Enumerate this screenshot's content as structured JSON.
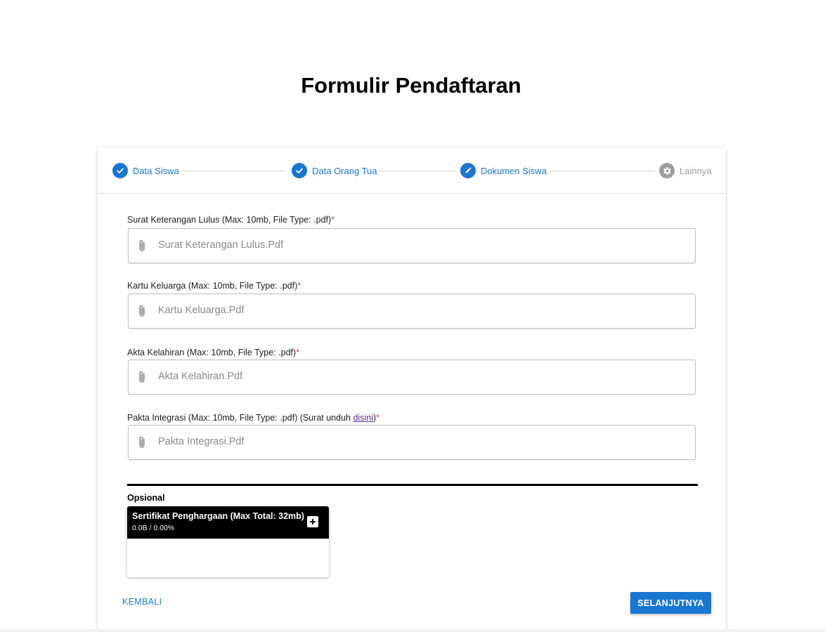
{
  "page": {
    "title": "Formulir Pendaftaran"
  },
  "stepper": {
    "steps": [
      {
        "label": "Data Siswa",
        "state": "complete",
        "icon": "check-icon"
      },
      {
        "label": "Data Orang Tua",
        "state": "complete",
        "icon": "check-icon"
      },
      {
        "label": "Dokumen Siswa",
        "state": "active",
        "icon": "pencil-icon"
      },
      {
        "label": "Lainnya",
        "state": "inactive",
        "icon": "gear-icon"
      }
    ]
  },
  "fields": [
    {
      "label": "Surat Keterangan Lulus (Max: 10mb, File Type: .pdf)",
      "required_mark": "*",
      "placeholder": "Surat Keterangan Lulus.Pdf"
    },
    {
      "label": "Kartu Keluarga (Max: 10mb, File Type: .pdf)",
      "required_mark": "*",
      "placeholder": "Kartu Keluarga.Pdf"
    },
    {
      "label": "Akta Kelahiran (Max: 10mb, File Type: .pdf)",
      "required_mark": "*",
      "placeholder": "Akta Kelahiran.Pdf"
    },
    {
      "label": "Pakta Integrasi (Max: 10mb, File Type: .pdf) (Surat unduh ",
      "link_text": "disini",
      "label_suffix": ")",
      "required_mark": "*",
      "placeholder": "Pakta Integrasi.Pdf"
    }
  ],
  "optional": {
    "section_title": "Opsional",
    "uploader": {
      "title": "Sertifikat Penghargaan (Max Total: 32mb)",
      "status": "0.0B / 0.00%",
      "add_icon": "plus-icon"
    }
  },
  "actions": {
    "back_label": "KEMBALI",
    "next_label": "SELANJUTNYA"
  },
  "colors": {
    "primary": "#1976d2",
    "inactive": "#9e9e9e",
    "required": "#e53935",
    "header_dark": "#000000"
  }
}
